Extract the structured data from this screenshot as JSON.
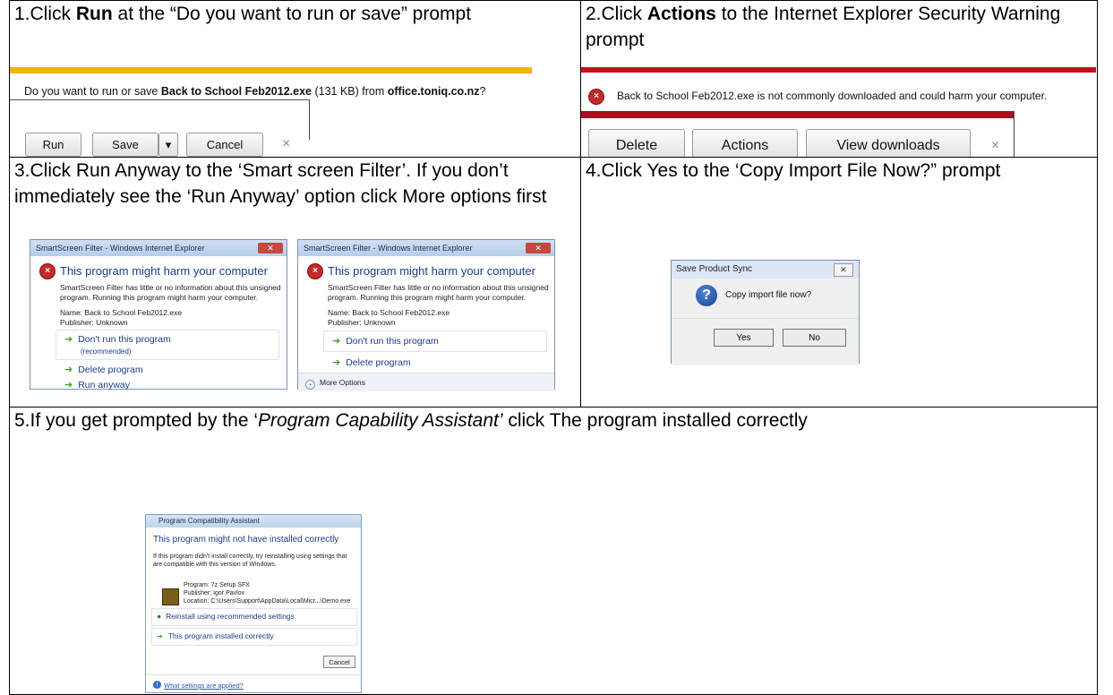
{
  "steps": {
    "s1": {
      "pre": "1.Click ",
      "bold": "Run",
      "post": " at the “Do you want to run or save” prompt"
    },
    "s2": {
      "pre": "2.Click ",
      "bold": "Actions",
      "post": " to the Internet Explorer Security Warning prompt"
    },
    "s3": {
      "text": "3.Click Run Anyway to the ‘Smart screen Filter’. If you don’t immediately see the ‘Run Anyway’ option click More options first"
    },
    "s4": {
      "text": "4.Click Yes to the ‘Copy Import File Now?” prompt"
    },
    "s5": {
      "pre": "5.If you get prompted by the ‘",
      "italic": "Program Capability Assistant’",
      "post": "  click The program installed correctly"
    }
  },
  "download_bar": {
    "text_pre": "Do you want to run or save ",
    "file": "Back to School Feb2012.exe",
    "size": " (131 KB) from ",
    "site": "office.toniq.co.nz",
    "text_end": "?",
    "run": "Run",
    "save": "Save",
    "dropdown": "▾",
    "cancel": "Cancel",
    "close": "×"
  },
  "security_bar": {
    "message": "Back to School Feb2012.exe is not commonly downloaded and could harm your computer.",
    "delete": "Delete",
    "actions": "Actions",
    "view_downloads": "View downloads",
    "close": "×"
  },
  "smartscreen": {
    "title": "SmartScreen Filter - Windows Internet Explorer",
    "close": "✕",
    "heading": "This program might harm your computer",
    "body1": "SmartScreen Filter has little or no information about this unsigned",
    "body2": "program. Running this program might harm your computer.",
    "name": "Name: Back to School Feb2012.exe",
    "publisher": "Publisher: Unknown",
    "dont_run": "Don't run this program",
    "recommended": "(recommended)",
    "delete_program": "Delete program",
    "run_anyway": "Run anyway",
    "more_options": "More Options",
    "arrow": "➔"
  },
  "save_sync": {
    "title": "Save Product Sync",
    "close": "✕",
    "message": "Copy import file now?",
    "yes": "Yes",
    "no": "No",
    "icon": "?"
  },
  "pca": {
    "title": "Program Compatibility Assistant",
    "heading": "This program might not have installed correctly",
    "body1": "If this program didn't install correctly, try reinstalling using settings that",
    "body2": "are compatible with this version of Windows.",
    "program": "Program: 7z Setup SFX",
    "publisher": "Publisher: Igor Pavlov",
    "location": "Location: C:\\Users\\Support\\AppData\\Local\\Micr...\\Demo.exe",
    "reinstall": "Reinstall using recommended settings",
    "installed": "This program installed correctly",
    "cancel": "Cancel",
    "link": "What settings are applied?"
  }
}
